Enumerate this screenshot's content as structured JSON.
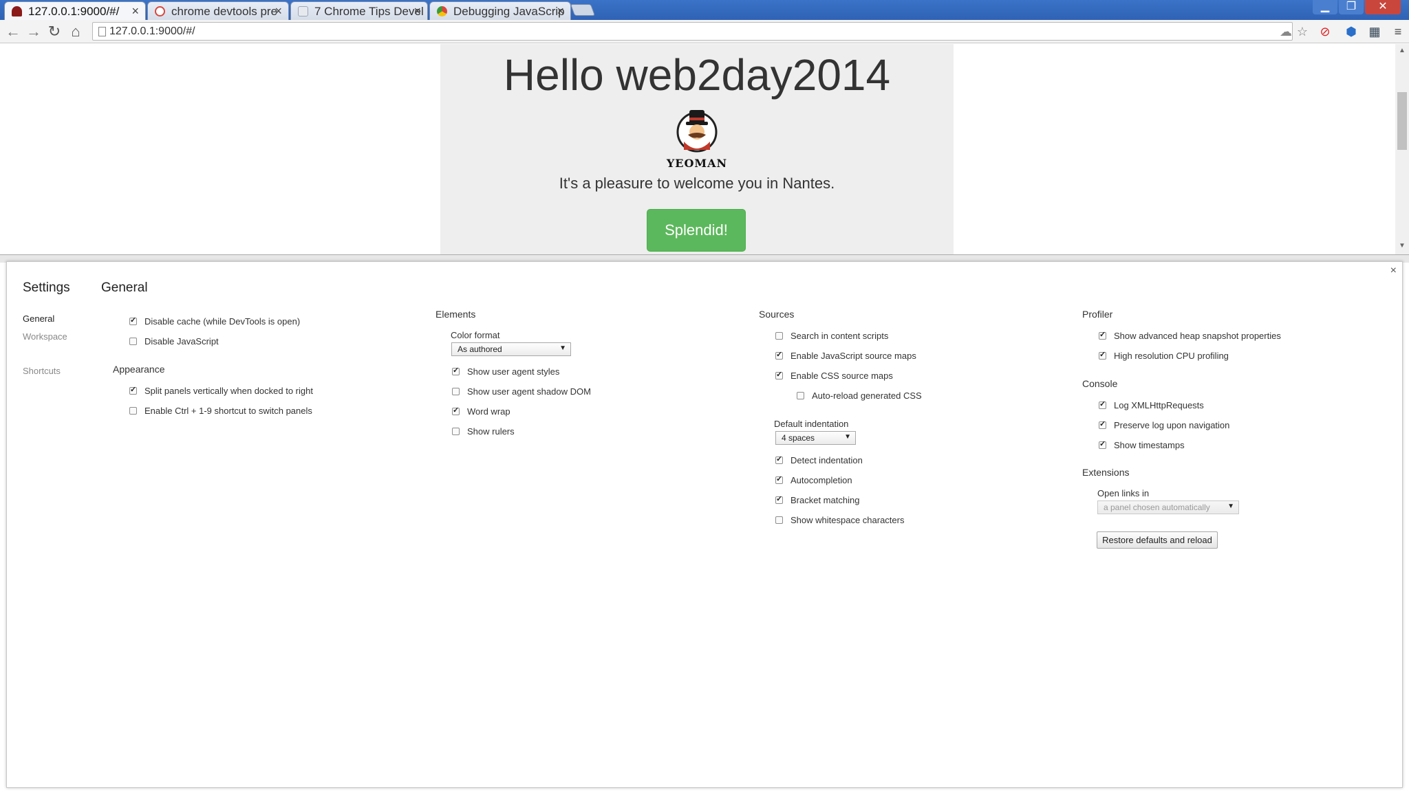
{
  "browser": {
    "tabs": [
      {
        "title": "127.0.0.1:9000/#/",
        "favicon": "yeoman-icon",
        "color": "#8b1a1a"
      },
      {
        "title": "chrome devtools pre",
        "favicon": "google-icon",
        "color": "#d9463b"
      },
      {
        "title": "7 Chrome Tips Devel",
        "favicon": "page-icon",
        "color": "#9aa6b8"
      },
      {
        "title": "Debugging JavaScrip",
        "favicon": "chrome-icon",
        "color": "#3a9b3a"
      }
    ],
    "url": "127.0.0.1:9000/#/"
  },
  "page": {
    "title": "Hello web2day2014",
    "logo_text": "YEOMAN",
    "welcome": "It's a pleasure to welcome you in Nantes.",
    "button": "Splendid!",
    "button_color": "#5cb85c"
  },
  "settings": {
    "title": "Settings",
    "heading": "General",
    "sidebar": [
      "General",
      "Workspace",
      "Shortcuts"
    ],
    "general": {
      "items": [
        {
          "label": "Disable cache (while DevTools is open)",
          "checked": true
        },
        {
          "label": "Disable JavaScript",
          "checked": false
        }
      ]
    },
    "appearance": {
      "title": "Appearance",
      "items": [
        {
          "label": "Split panels vertically when docked to right",
          "checked": true
        },
        {
          "label": "Enable Ctrl + 1-9 shortcut to switch panels",
          "checked": false
        }
      ]
    },
    "elements": {
      "title": "Elements",
      "color_format_label": "Color format",
      "color_format_value": "As authored",
      "items": [
        {
          "label": "Show user agent styles",
          "checked": true
        },
        {
          "label": "Show user agent shadow DOM",
          "checked": false
        },
        {
          "label": "Word wrap",
          "checked": true
        },
        {
          "label": "Show rulers",
          "checked": false
        }
      ]
    },
    "sources": {
      "title": "Sources",
      "items": [
        {
          "label": "Search in content scripts",
          "checked": false
        },
        {
          "label": "Enable JavaScript source maps",
          "checked": true
        },
        {
          "label": "Enable CSS source maps",
          "checked": true
        }
      ],
      "sub_item": {
        "label": "Auto-reload generated CSS",
        "checked": false
      },
      "indent_label": "Default indentation",
      "indent_value": "4 spaces",
      "items2": [
        {
          "label": "Detect indentation",
          "checked": true
        },
        {
          "label": "Autocompletion",
          "checked": true
        },
        {
          "label": "Bracket matching",
          "checked": true
        },
        {
          "label": "Show whitespace characters",
          "checked": false
        }
      ]
    },
    "profiler": {
      "title": "Profiler",
      "items": [
        {
          "label": "Show advanced heap snapshot properties",
          "checked": true
        },
        {
          "label": "High resolution CPU profiling",
          "checked": true
        }
      ]
    },
    "console": {
      "title": "Console",
      "items": [
        {
          "label": "Log XMLHttpRequests",
          "checked": true
        },
        {
          "label": "Preserve log upon navigation",
          "checked": true
        },
        {
          "label": "Show timestamps",
          "checked": true
        }
      ]
    },
    "extensions": {
      "title": "Extensions",
      "open_links_label": "Open links in",
      "open_links_value": "a panel chosen automatically"
    },
    "restore_button": "Restore defaults and reload"
  }
}
